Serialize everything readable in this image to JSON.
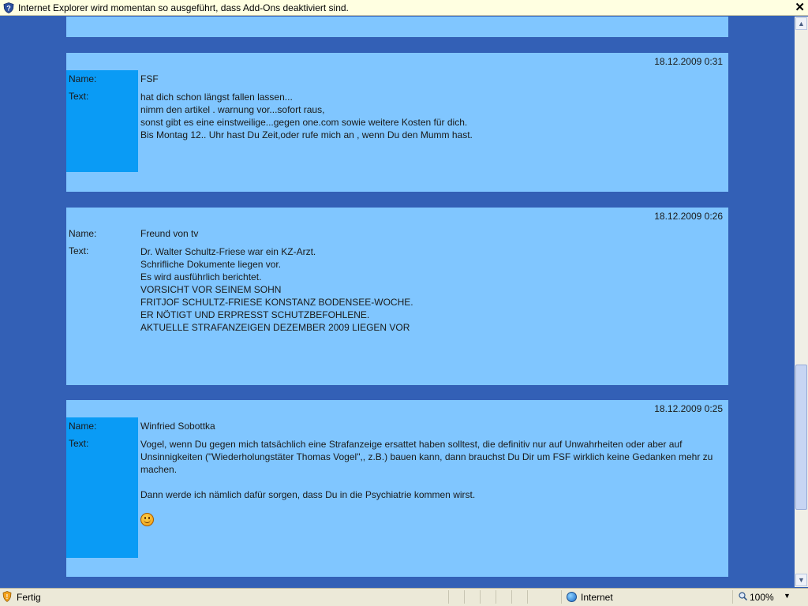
{
  "infobar": {
    "message": "Internet Explorer wird momentan so ausgeführt, dass Add-Ons deaktiviert sind.",
    "close": "✕"
  },
  "colors": {
    "background": "#3360b6",
    "panel": "#80c6ff",
    "label_column": "#0a9bf5"
  },
  "entries": [
    {
      "date": "18.12.2009 0:31",
      "name_label": "Name:",
      "name": "FSF",
      "text_label": "Text:",
      "lines": [
        "hat dich schon längst fallen lassen...",
        "nimm den artikel . warnung vor...sofort raus,",
        "sonst gibt es eine einstweilige...gegen one.com sowie weitere Kosten für dich.",
        "Bis Montag 12.. Uhr hast Du Zeit,oder rufe mich an , wenn Du den Mumm hast."
      ]
    },
    {
      "date": "18.12.2009 0:26",
      "name_label": "Name:",
      "name": "Freund von tv",
      "text_label": "Text:",
      "lines": [
        "Dr. Walter Schultz-Friese war ein KZ-Arzt.",
        "Schrifliche Dokumente liegen vor.",
        "Es wird ausführlich berichtet.",
        "VORSICHT VOR SEINEM SOHN",
        "FRITJOF SCHULTZ-FRIESE KONSTANZ BODENSEE-WOCHE.",
        "ER NÖTIGT UND ERPRESST SCHUTZBEFOHLENE.",
        "AKTUELLE STRAFANZEIGEN DEZEMBER 2009 LIEGEN VOR"
      ]
    },
    {
      "date": "18.12.2009 0:25",
      "name_label": "Name:",
      "name": "Winfried Sobottka",
      "text_label": "Text:",
      "lines": [
        "Vogel, wenn Du gegen mich tatsächlich eine Strafanzeige ersattet haben solltest, die definitiv nur auf Unwahrheiten oder aber auf Unsinnigkeiten (\"Wiederholungstäter Thomas Vogel\",, z.B.) bauen kann, dann brauchst Du Dir um FSF wirklich keine Gedanken mehr zu machen.",
        "",
        "Dann werde ich nämlich dafür sorgen, dass Du in die Psychiatrie kommen wirst."
      ],
      "emoticon": "smiley-icon"
    }
  ],
  "statusbar": {
    "status": "Fertig",
    "zone": "Internet",
    "zoom": "100%"
  }
}
